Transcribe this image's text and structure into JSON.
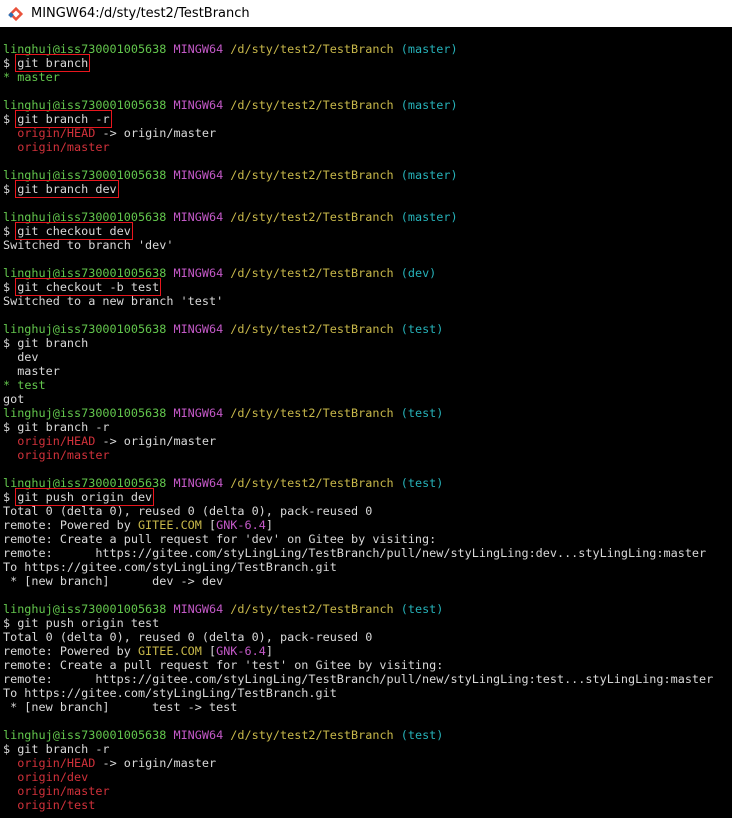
{
  "window": {
    "title": "MINGW64:/d/sty/test2/TestBranch",
    "icon": "git-bash-icon"
  },
  "colors": {
    "user_host": "#63c74d",
    "shell": "#c459c8",
    "path": "#c8b84a",
    "branch": "#26b1b8",
    "remote_branch": "#d0313a",
    "text": "#d9d9d9",
    "highlight_box": "#e8161d"
  },
  "terminal": {
    "lines": [
      {
        "segs": [
          [
            "linghuj@iss730001005638",
            "g"
          ],
          [
            " ",
            "w"
          ],
          [
            "MINGW64",
            "m"
          ],
          [
            " ",
            "w"
          ],
          [
            "/d/sty/test2/TestBranch",
            "y"
          ],
          [
            " ",
            "w"
          ],
          [
            "(master)",
            "c"
          ]
        ]
      },
      {
        "segs": [
          [
            "$ ",
            "w"
          ],
          [
            "git branch",
            "w",
            1
          ]
        ]
      },
      {
        "segs": [
          [
            "* ",
            "g"
          ],
          [
            "master",
            "g"
          ]
        ]
      },
      {
        "segs": [
          [
            "",
            "w"
          ]
        ]
      },
      {
        "segs": [
          [
            "linghuj@iss730001005638",
            "g"
          ],
          [
            " ",
            "w"
          ],
          [
            "MINGW64",
            "m"
          ],
          [
            " ",
            "w"
          ],
          [
            "/d/sty/test2/TestBranch",
            "y"
          ],
          [
            " ",
            "w"
          ],
          [
            "(master)",
            "c"
          ]
        ]
      },
      {
        "segs": [
          [
            "$ ",
            "w"
          ],
          [
            "git branch -r",
            "w",
            1
          ]
        ]
      },
      {
        "segs": [
          [
            "  ",
            "w"
          ],
          [
            "origin/HEAD",
            "r"
          ],
          [
            " -> origin/master",
            "w"
          ]
        ]
      },
      {
        "segs": [
          [
            "  ",
            "w"
          ],
          [
            "origin/master",
            "r"
          ]
        ]
      },
      {
        "segs": [
          [
            "",
            "w"
          ]
        ]
      },
      {
        "segs": [
          [
            "linghuj@iss730001005638",
            "g"
          ],
          [
            " ",
            "w"
          ],
          [
            "MINGW64",
            "m"
          ],
          [
            " ",
            "w"
          ],
          [
            "/d/sty/test2/TestBranch",
            "y"
          ],
          [
            " ",
            "w"
          ],
          [
            "(master)",
            "c"
          ]
        ]
      },
      {
        "segs": [
          [
            "$ ",
            "w"
          ],
          [
            "git branch dev",
            "w",
            1
          ]
        ]
      },
      {
        "segs": [
          [
            "",
            "w"
          ]
        ]
      },
      {
        "segs": [
          [
            "linghuj@iss730001005638",
            "g"
          ],
          [
            " ",
            "w"
          ],
          [
            "MINGW64",
            "m"
          ],
          [
            " ",
            "w"
          ],
          [
            "/d/sty/test2/TestBranch",
            "y"
          ],
          [
            " ",
            "w"
          ],
          [
            "(master)",
            "c"
          ]
        ]
      },
      {
        "segs": [
          [
            "$ ",
            "w"
          ],
          [
            "git checkout dev",
            "w",
            1
          ]
        ]
      },
      {
        "segs": [
          [
            "Switched to branch 'dev'",
            "w"
          ]
        ]
      },
      {
        "segs": [
          [
            "",
            "w"
          ]
        ]
      },
      {
        "segs": [
          [
            "linghuj@iss730001005638",
            "g"
          ],
          [
            " ",
            "w"
          ],
          [
            "MINGW64",
            "m"
          ],
          [
            " ",
            "w"
          ],
          [
            "/d/sty/test2/TestBranch",
            "y"
          ],
          [
            " ",
            "w"
          ],
          [
            "(dev)",
            "c"
          ]
        ]
      },
      {
        "segs": [
          [
            "$ ",
            "w"
          ],
          [
            "git checkout -b test",
            "w",
            1
          ]
        ]
      },
      {
        "segs": [
          [
            "Switched to a new branch 'test'",
            "w"
          ]
        ]
      },
      {
        "segs": [
          [
            "",
            "w"
          ]
        ]
      },
      {
        "segs": [
          [
            "linghuj@iss730001005638",
            "g"
          ],
          [
            " ",
            "w"
          ],
          [
            "MINGW64",
            "m"
          ],
          [
            " ",
            "w"
          ],
          [
            "/d/sty/test2/TestBranch",
            "y"
          ],
          [
            " ",
            "w"
          ],
          [
            "(test)",
            "c"
          ]
        ]
      },
      {
        "segs": [
          [
            "$ git branch",
            "w"
          ]
        ]
      },
      {
        "segs": [
          [
            "  dev",
            "w"
          ]
        ]
      },
      {
        "segs": [
          [
            "  master",
            "w"
          ]
        ]
      },
      {
        "segs": [
          [
            "* ",
            "g"
          ],
          [
            "test",
            "g"
          ]
        ]
      },
      {
        "segs": [
          [
            "got",
            "w"
          ]
        ]
      },
      {
        "segs": [
          [
            "linghuj@iss730001005638",
            "g"
          ],
          [
            " ",
            "w"
          ],
          [
            "MINGW64",
            "m"
          ],
          [
            " ",
            "w"
          ],
          [
            "/d/sty/test2/TestBranch",
            "y"
          ],
          [
            " ",
            "w"
          ],
          [
            "(test)",
            "c"
          ]
        ]
      },
      {
        "segs": [
          [
            "$ git branch -r",
            "w"
          ]
        ]
      },
      {
        "segs": [
          [
            "  ",
            "w"
          ],
          [
            "origin/HEAD",
            "r"
          ],
          [
            " -> origin/master",
            "w"
          ]
        ]
      },
      {
        "segs": [
          [
            "  ",
            "w"
          ],
          [
            "origin/master",
            "r"
          ]
        ]
      },
      {
        "segs": [
          [
            "",
            "w"
          ]
        ]
      },
      {
        "segs": [
          [
            "linghuj@iss730001005638",
            "g"
          ],
          [
            " ",
            "w"
          ],
          [
            "MINGW64",
            "m"
          ],
          [
            " ",
            "w"
          ],
          [
            "/d/sty/test2/TestBranch",
            "y"
          ],
          [
            " ",
            "w"
          ],
          [
            "(test)",
            "c"
          ]
        ]
      },
      {
        "segs": [
          [
            "$ ",
            "w"
          ],
          [
            "git push origin dev",
            "w",
            1
          ]
        ]
      },
      {
        "segs": [
          [
            "Total 0 (delta 0), reused 0 (delta 0), pack-reused 0",
            "w"
          ]
        ]
      },
      {
        "segs": [
          [
            "remote: Powered by ",
            "w"
          ],
          [
            "GITEE.COM",
            "y"
          ],
          [
            " ",
            "w"
          ],
          [
            "[",
            "w"
          ],
          [
            "GNK-6.4",
            "m"
          ],
          [
            "]",
            "w"
          ]
        ]
      },
      {
        "segs": [
          [
            "remote: Create a pull request for 'dev' on Gitee by visiting:",
            "w"
          ]
        ]
      },
      {
        "segs": [
          [
            "remote:      https://gitee.com/styLingLing/TestBranch/pull/new/styLingLing:dev...styLingLing:master",
            "w"
          ]
        ]
      },
      {
        "segs": [
          [
            "To https://gitee.com/styLingLing/TestBranch.git",
            "w"
          ]
        ]
      },
      {
        "segs": [
          [
            " * [new branch]      dev -> dev",
            "w"
          ]
        ]
      },
      {
        "segs": [
          [
            "",
            "w"
          ]
        ]
      },
      {
        "segs": [
          [
            "linghuj@iss730001005638",
            "g"
          ],
          [
            " ",
            "w"
          ],
          [
            "MINGW64",
            "m"
          ],
          [
            " ",
            "w"
          ],
          [
            "/d/sty/test2/TestBranch",
            "y"
          ],
          [
            " ",
            "w"
          ],
          [
            "(test)",
            "c"
          ]
        ]
      },
      {
        "segs": [
          [
            "$ git push origin test",
            "w"
          ]
        ]
      },
      {
        "segs": [
          [
            "Total 0 (delta 0), reused 0 (delta 0), pack-reused 0",
            "w"
          ]
        ]
      },
      {
        "segs": [
          [
            "remote: Powered by ",
            "w"
          ],
          [
            "GITEE.COM",
            "y"
          ],
          [
            " ",
            "w"
          ],
          [
            "[",
            "w"
          ],
          [
            "GNK-6.4",
            "m"
          ],
          [
            "]",
            "w"
          ]
        ]
      },
      {
        "segs": [
          [
            "remote: Create a pull request for 'test' on Gitee by visiting:",
            "w"
          ]
        ]
      },
      {
        "segs": [
          [
            "remote:      https://gitee.com/styLingLing/TestBranch/pull/new/styLingLing:test...styLingLing:master",
            "w"
          ]
        ]
      },
      {
        "segs": [
          [
            "To https://gitee.com/styLingLing/TestBranch.git",
            "w"
          ]
        ]
      },
      {
        "segs": [
          [
            " * [new branch]      test -> test",
            "w"
          ]
        ]
      },
      {
        "segs": [
          [
            "",
            "w"
          ]
        ]
      },
      {
        "segs": [
          [
            "linghuj@iss730001005638",
            "g"
          ],
          [
            " ",
            "w"
          ],
          [
            "MINGW64",
            "m"
          ],
          [
            " ",
            "w"
          ],
          [
            "/d/sty/test2/TestBranch",
            "y"
          ],
          [
            " ",
            "w"
          ],
          [
            "(test)",
            "c"
          ]
        ]
      },
      {
        "segs": [
          [
            "$ git branch -r",
            "w"
          ]
        ]
      },
      {
        "segs": [
          [
            "  ",
            "w"
          ],
          [
            "origin/HEAD",
            "r"
          ],
          [
            " -> origin/master",
            "w"
          ]
        ]
      },
      {
        "segs": [
          [
            "  ",
            "w"
          ],
          [
            "origin/dev",
            "r"
          ]
        ]
      },
      {
        "segs": [
          [
            "  ",
            "w"
          ],
          [
            "origin/master",
            "r"
          ]
        ]
      },
      {
        "segs": [
          [
            "  ",
            "w"
          ],
          [
            "origin/test",
            "r"
          ]
        ]
      }
    ]
  }
}
